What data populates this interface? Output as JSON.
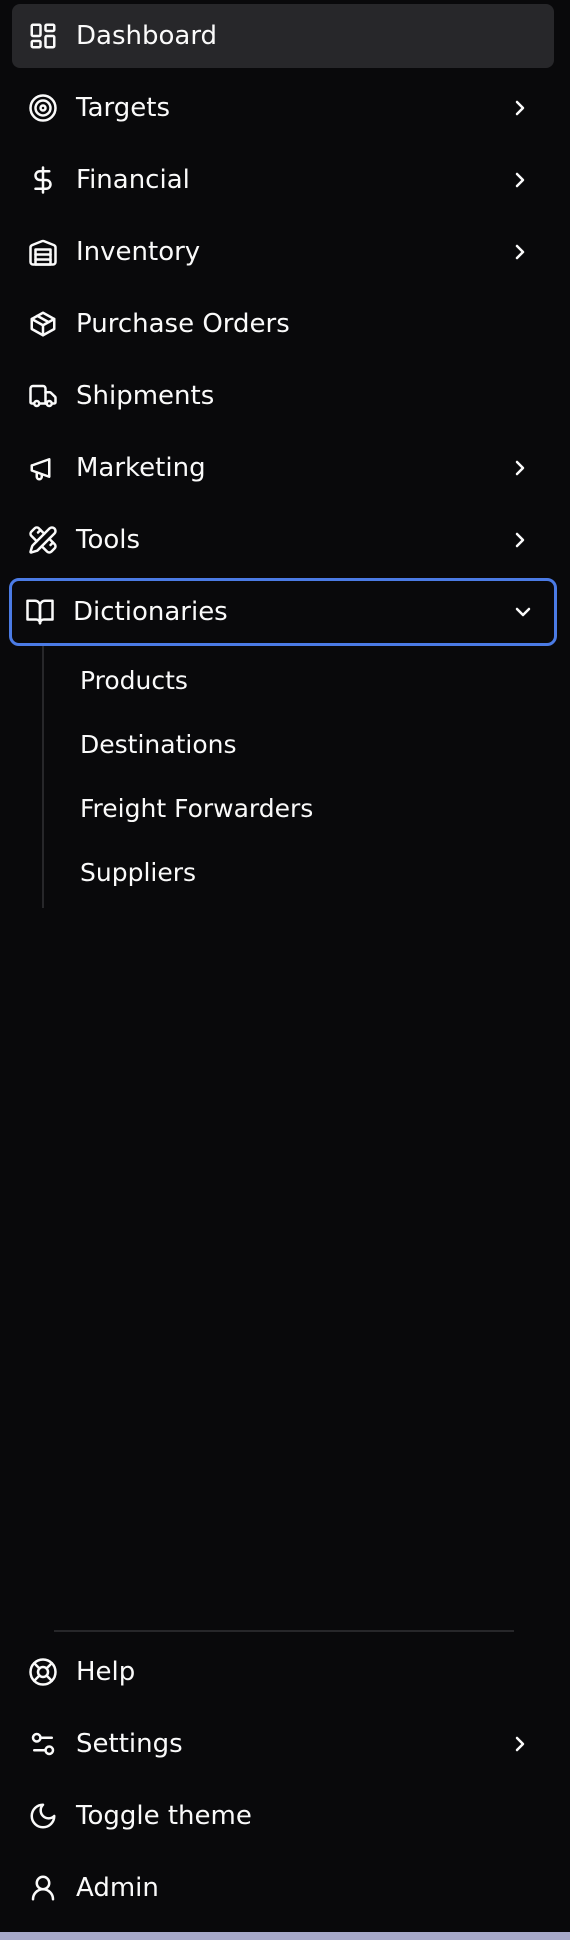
{
  "nav": {
    "items": [
      {
        "label": "Dashboard",
        "icon": "dashboard-icon"
      },
      {
        "label": "Targets",
        "icon": "target-icon"
      },
      {
        "label": "Financial",
        "icon": "dollar-icon"
      },
      {
        "label": "Inventory",
        "icon": "warehouse-icon"
      },
      {
        "label": "Purchase Orders",
        "icon": "package-icon"
      },
      {
        "label": "Shipments",
        "icon": "truck-icon"
      },
      {
        "label": "Marketing",
        "icon": "megaphone-icon"
      },
      {
        "label": "Tools",
        "icon": "pencil-ruler-icon"
      },
      {
        "label": "Dictionaries",
        "icon": "book-open-icon"
      }
    ],
    "dictionaries_children": [
      {
        "label": "Products"
      },
      {
        "label": "Destinations"
      },
      {
        "label": "Freight Forwarders"
      },
      {
        "label": "Suppliers"
      }
    ]
  },
  "footer": {
    "items": [
      {
        "label": "Help",
        "icon": "life-buoy-icon"
      },
      {
        "label": "Settings",
        "icon": "settings-sliders-icon"
      },
      {
        "label": "Toggle theme",
        "icon": "moon-icon"
      },
      {
        "label": "Admin",
        "icon": "user-icon"
      }
    ]
  },
  "colors": {
    "background": "#09090b",
    "active_bg": "#27272a",
    "focus_ring": "#4b7be5",
    "text": "#fafafa"
  }
}
